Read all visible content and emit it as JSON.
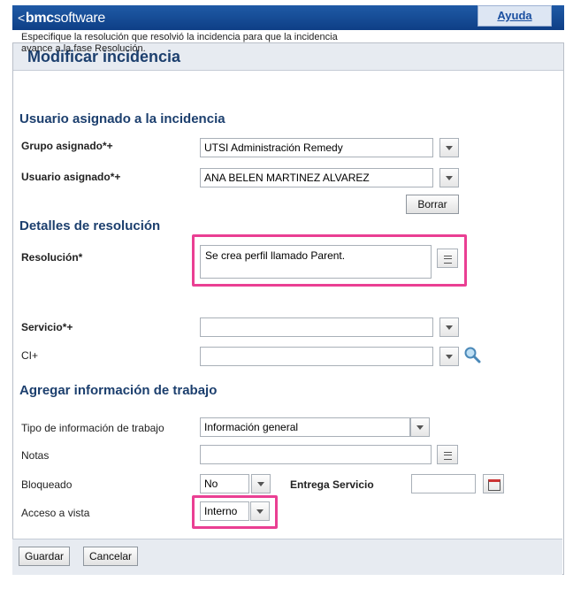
{
  "header": {
    "brand_arrow": "<",
    "brand_bold": "bmc",
    "brand_rest": "software",
    "help_link": "Ayuda"
  },
  "panel": {
    "title": "Modificar incidencia",
    "description_line1": "Especifique la resolución que resolvió la incidencia para que la incidencia",
    "description_line2": "avance a la fase Resolución."
  },
  "assigned_section": {
    "heading": "Usuario asignado a la incidencia",
    "group_label": "Grupo asignado*+",
    "group_value": "UTSI  Administración Remedy",
    "user_label": "Usuario asignado*+",
    "user_value": "ANA BELEN MARTINEZ ALVAREZ",
    "clear_button": "Borrar"
  },
  "resolution_section": {
    "heading": "Detalles de resolución",
    "resolution_label": "Resolución*",
    "resolution_value": "Se crea perfil llamado Parent.",
    "service_label": "Servicio*+",
    "service_value": "",
    "ci_label": "CI+",
    "ci_value": ""
  },
  "worklog_section": {
    "heading": "Agregar información de trabajo",
    "type_label": "Tipo de información de trabajo",
    "type_value": "Información general",
    "notes_label": "Notas",
    "notes_value": "",
    "locked_label": "Bloqueado",
    "locked_value": "No",
    "delivery_label": "Entrega Servicio",
    "delivery_value": "",
    "access_label": "Acceso a vista",
    "access_value": "Interno"
  },
  "footer": {
    "save_button": "Guardar",
    "cancel_button": "Cancelar"
  },
  "colors": {
    "brand_blue": "#0e3f86",
    "title_text": "#1c3f6e",
    "highlight": "#ea3f93"
  }
}
